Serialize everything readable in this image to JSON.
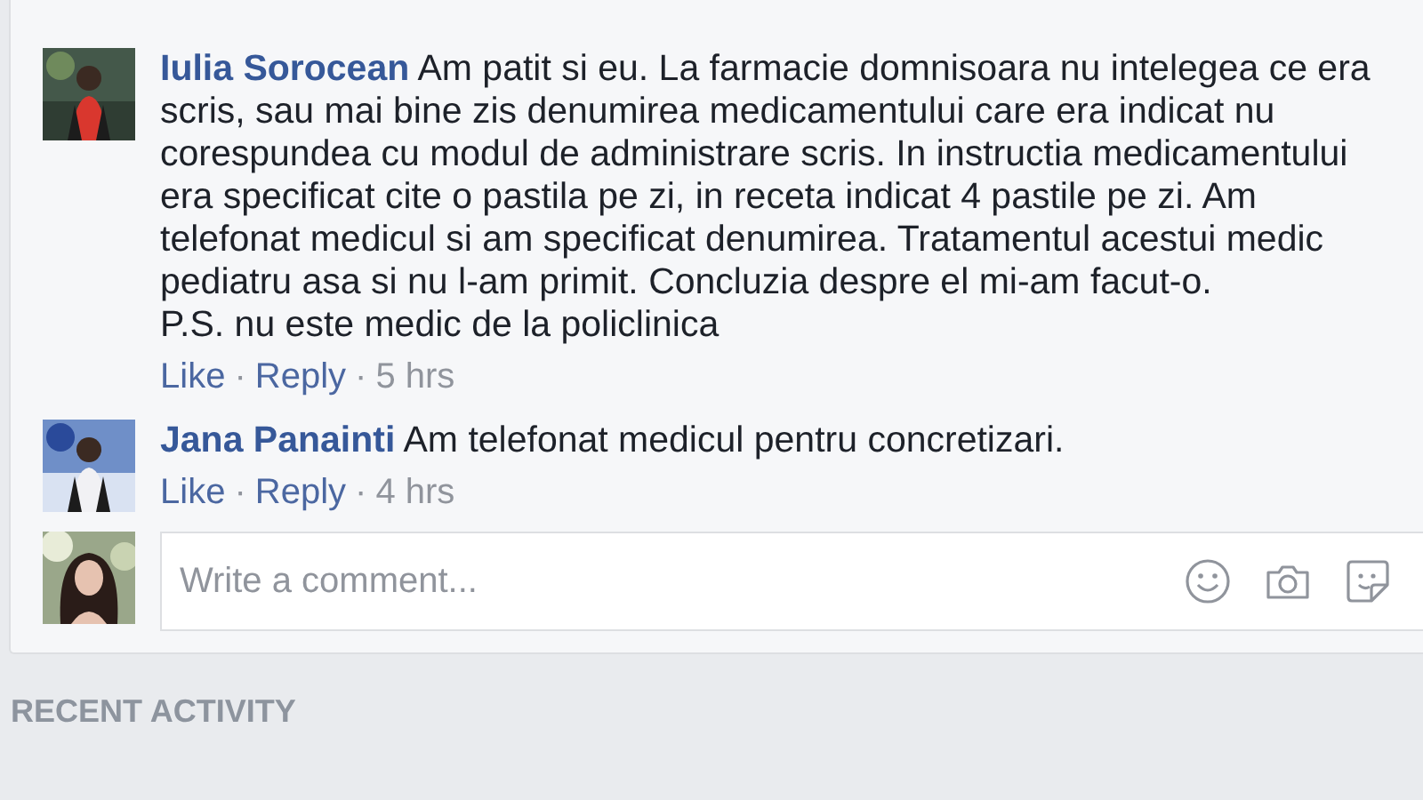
{
  "comments": [
    {
      "author": "Iulia Sorocean",
      "text": "Am patit si eu. La farmacie domnisoara nu intelegea ce era scris, sau mai bine zis denumirea medicamentului care era indicat nu corespundea cu modul de administrare scris. In instructia medicamentului era specificat cite o pastila pe zi, in receta indicat 4 pastile pe zi. Am telefonat medicul si am specificat denumirea. Tratamentul acestui medic pediatru asa si nu l-am primit. Concluzia despre el mi-am facut-o.\nP.S. nu este medic de la policlinica",
      "actions": [
        "Like",
        "Reply"
      ],
      "separator": "·",
      "time": "5 hrs"
    },
    {
      "author": "Jana Panainti",
      "text": "Am telefonat medicul pentru concretizari.",
      "actions": [
        "Like",
        "Reply"
      ],
      "separator": "·",
      "time": "4 hrs"
    }
  ],
  "composer": {
    "placeholder": "Write a comment..."
  },
  "section_heading": "RECENT ACTIVITY"
}
